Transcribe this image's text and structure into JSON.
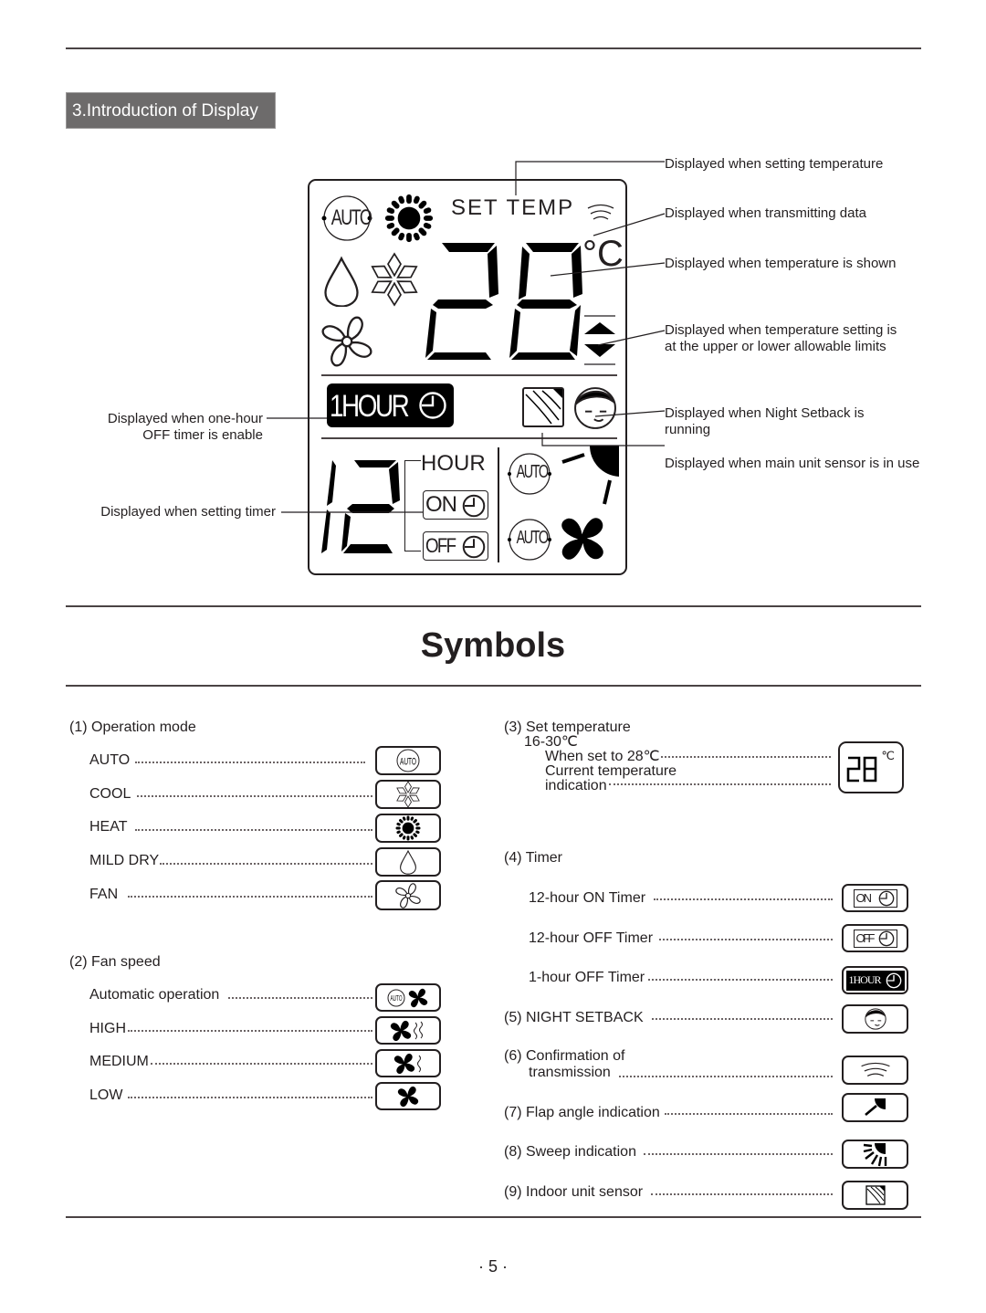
{
  "section": {
    "tag": "3.Introduction of Display"
  },
  "lcd": {
    "set_temp_label": "SET TEMP",
    "temperature": "28",
    "temp_unit": "°C",
    "one_hour_label": "1HOUR",
    "timer_hours": "12",
    "hour_label": "HOUR",
    "on_label": "ON",
    "off_label": "OFF",
    "auto_label": "AUTO"
  },
  "callouts": {
    "setting_temperature": "Displayed when setting temperature",
    "transmitting_data": "Displayed when transmitting data",
    "temperature_shown": "Displayed when temperature is shown",
    "temp_limits": "Displayed when temperature setting is at the upper or lower allowable limits",
    "night_setback": "Displayed when Night Setback is running",
    "main_sensor": "Displayed when main unit sensor is in use",
    "one_hour_off_line1": "Displayed when one-hour",
    "one_hour_off_line2": "OFF timer is enable",
    "setting_timer": "Displayed when setting timer"
  },
  "symbols": {
    "title": "Symbols",
    "operation_mode": {
      "heading": "(1) Operation mode",
      "items": [
        {
          "label": "AUTO",
          "icon": "auto-mode-icon"
        },
        {
          "label": "COOL",
          "icon": "snowflake-icon"
        },
        {
          "label": "HEAT",
          "icon": "sun-icon"
        },
        {
          "label": "MILD DRY",
          "icon": "droplet-icon"
        },
        {
          "label": "FAN",
          "icon": "fan-outline-icon"
        }
      ]
    },
    "fan_speed": {
      "heading": "(2) Fan speed",
      "items": [
        {
          "label": "Automatic operation",
          "icon": "auto-fan-icon"
        },
        {
          "label": "HIGH",
          "icon": "fan-high-icon"
        },
        {
          "label": "MEDIUM",
          "icon": "fan-medium-icon"
        },
        {
          "label": "LOW",
          "icon": "fan-low-icon"
        }
      ]
    },
    "set_temperature": {
      "heading": "(3) Set temperature",
      "range": "16-30℃",
      "line1": "When set to 28℃",
      "line2": "Current temperature",
      "line3": "indication",
      "display_value": "28",
      "display_unit": "℃"
    },
    "timer": {
      "heading": "(4) Timer",
      "items": [
        {
          "label": "12-hour ON Timer",
          "badge": "ON"
        },
        {
          "label": "12-hour OFF Timer",
          "badge": "OFF"
        },
        {
          "label": "1-hour OFF Timer",
          "badge": "1HOUR"
        }
      ]
    },
    "night_setback": {
      "heading": "(5) NIGHT SETBACK"
    },
    "transmission": {
      "line1": "(6) Confirmation of",
      "line2": "transmission"
    },
    "flap": {
      "heading": "(7) Flap angle indication"
    },
    "sweep": {
      "heading": "(8) Sweep indication"
    },
    "sensor": {
      "heading": "(9) Indoor unit sensor"
    }
  },
  "footer": {
    "page_number": "· 5 ·"
  }
}
